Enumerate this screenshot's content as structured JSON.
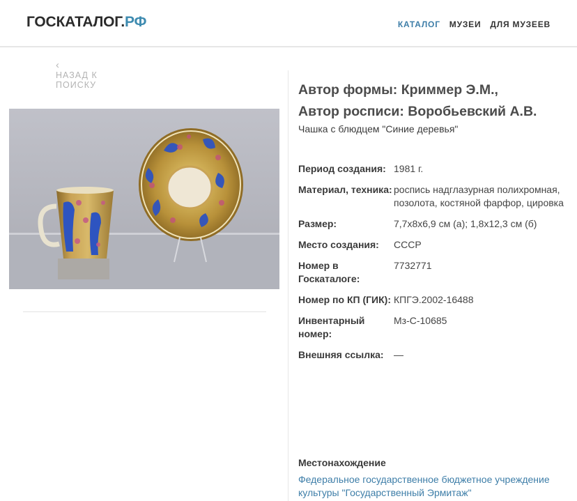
{
  "header": {
    "logo_main": "ГОСКАТАЛОГ.",
    "logo_suffix": "РФ",
    "nav": [
      "КАТАЛОГ",
      "МУЗЕИ",
      "ДЛЯ МУЗЕЕВ"
    ]
  },
  "back_link": {
    "icon": "chevron-left-icon",
    "label": "НАЗАД К ПОИСКУ"
  },
  "item": {
    "title_line1": "Автор формы: Криммер Э.М.,",
    "title_line2": "Автор росписи: Воробьевский А.В.",
    "subtitle": "Чашка с блюдцем \"Синие деревья\"",
    "properties": [
      {
        "label": "Период создания:",
        "value": "1981 г."
      },
      {
        "label": "Материал, техника:",
        "value": "роспись надглазурная полихромная, позолота, костяной фарфор, цировка"
      },
      {
        "label": "Размер:",
        "value": "7,7х8х6,9 см (а); 1,8х12,3 см (б)"
      },
      {
        "label": "Место создания:",
        "value": "СССР"
      },
      {
        "label": "Номер в Госкаталоге:",
        "value": "7732771"
      },
      {
        "label": "Номер по КП (ГИК):",
        "value": "КПГЭ.2002-16488"
      },
      {
        "label": "Инвентарный номер:",
        "value": "Мз-С-10685"
      },
      {
        "label": "Внешняя ссылка:",
        "value": "—"
      }
    ],
    "location_label": "Местонахождение",
    "location_value": "Федеральное государственное бюджетное учреждение культуры \"Государственный Эрмитаж\""
  },
  "colors": {
    "accent": "#3e7ea8",
    "logo_accent": "#3e8bb0",
    "muted": "#b3b3b3"
  }
}
